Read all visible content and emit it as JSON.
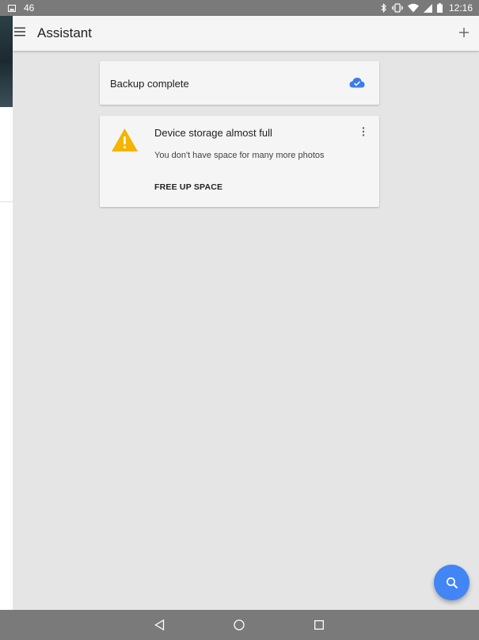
{
  "status_bar": {
    "notification_count": "46",
    "time": "12:16"
  },
  "app_bar": {
    "title": "Assistant"
  },
  "cards": {
    "backup": {
      "label": "Backup complete"
    },
    "storage": {
      "title": "Device storage almost full",
      "description": "You don't have space for many more photos",
      "action_label": "FREE UP SPACE"
    }
  },
  "icons": {
    "menu": "menu-icon",
    "add": "add-icon",
    "cloud_done": "cloud-done-icon",
    "warning": "warning-icon",
    "more": "more-vert-icon",
    "search": "search-icon",
    "back": "back-icon",
    "home": "home-icon",
    "recents": "recents-icon"
  },
  "colors": {
    "accent": "#4285f4",
    "warning": "#f4b400",
    "bars": "#7a7a7a",
    "background": "#e5e5e5",
    "card": "#f5f5f5"
  }
}
